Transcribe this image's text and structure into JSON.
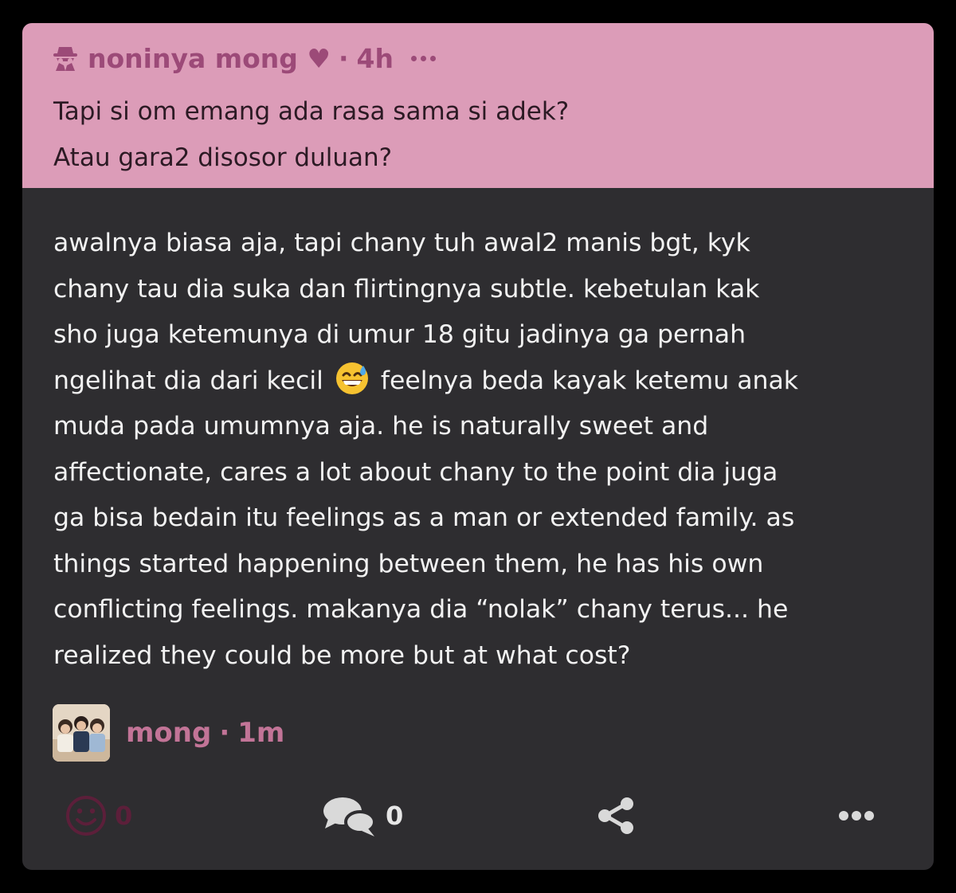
{
  "quoted_post": {
    "author": "noninya mong ♥",
    "separator": "·",
    "time": "4h",
    "lines": [
      "Tapi si om emang ada rasa sama si adek?",
      "Atau gara2 disosor duluan?"
    ]
  },
  "reply": {
    "lines": [
      "awalnya biasa aja, tapi chany tuh awal2 manis bgt, kyk",
      "chany tau dia suka dan flirtingnya subtle. kebetulan kak",
      "sho juga ketemunya di umur 18 gitu jadinya ga pernah"
    ],
    "line4_before_emoji": "ngelihat dia dari kecil",
    "line4_after_emoji": "feelnya beda kayak ketemu anak",
    "lines_rest": [
      "muda pada umumnya aja. he is naturally sweet and",
      "affectionate, cares a lot about chany to the point dia juga",
      "ga bisa bedain itu feelings as a man or extended family. as",
      "things started happening between them, he has his own",
      "conflicting feelings. makanya dia “nolak” chany terus... he",
      "realized they could be more but at what cost?"
    ],
    "emoji": "grinning-sweat-emoji"
  },
  "author": {
    "name": "mong",
    "separator": "·",
    "time": "1m"
  },
  "actions": {
    "reactions_count": "0",
    "comments_count": "0"
  },
  "colors": {
    "quote_bg": "#dc9cb8",
    "card_bg": "#2e2d30",
    "accent": "#9c4a78",
    "author_pink": "#c27497"
  }
}
